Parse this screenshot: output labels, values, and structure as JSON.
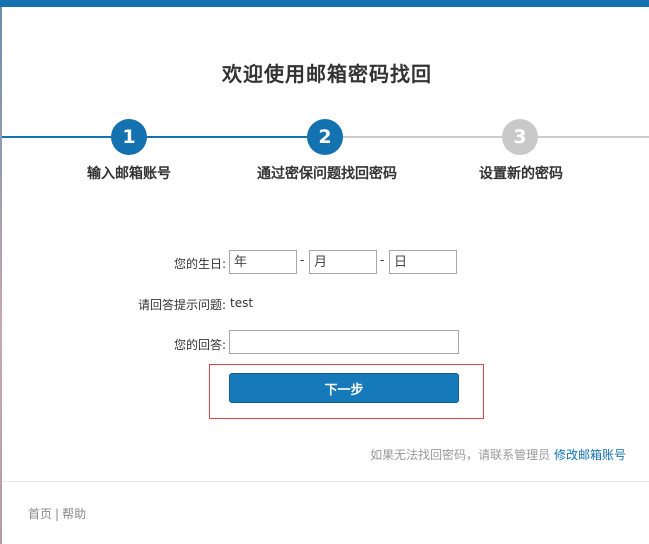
{
  "page": {
    "title": "欢迎使用邮箱密码找回"
  },
  "steps": [
    {
      "number": "1",
      "label": "输入邮箱账号",
      "state": "done"
    },
    {
      "number": "2",
      "label": "通过密保问题找回密码",
      "state": "current"
    },
    {
      "number": "3",
      "label": "设置新的密码",
      "state": "pending"
    }
  ],
  "form": {
    "birthday_label": "您的生日:",
    "year_placeholder": "年",
    "month_placeholder": "月",
    "day_placeholder": "日",
    "separator": "-",
    "question_label": "请回答提示问题:",
    "question_value": "test",
    "answer_label": "您的回答:",
    "answer_value": "",
    "next_button": "下一步"
  },
  "help": {
    "text": "如果无法找回密码，请联系管理员",
    "link": "修改邮箱账号"
  },
  "footer": {
    "home": "首页",
    "separator": "|",
    "help": "帮助"
  },
  "colors": {
    "accent": "#1472b0",
    "inactive_step": "#c9c9c9",
    "highlight_border": "#e0464c"
  }
}
